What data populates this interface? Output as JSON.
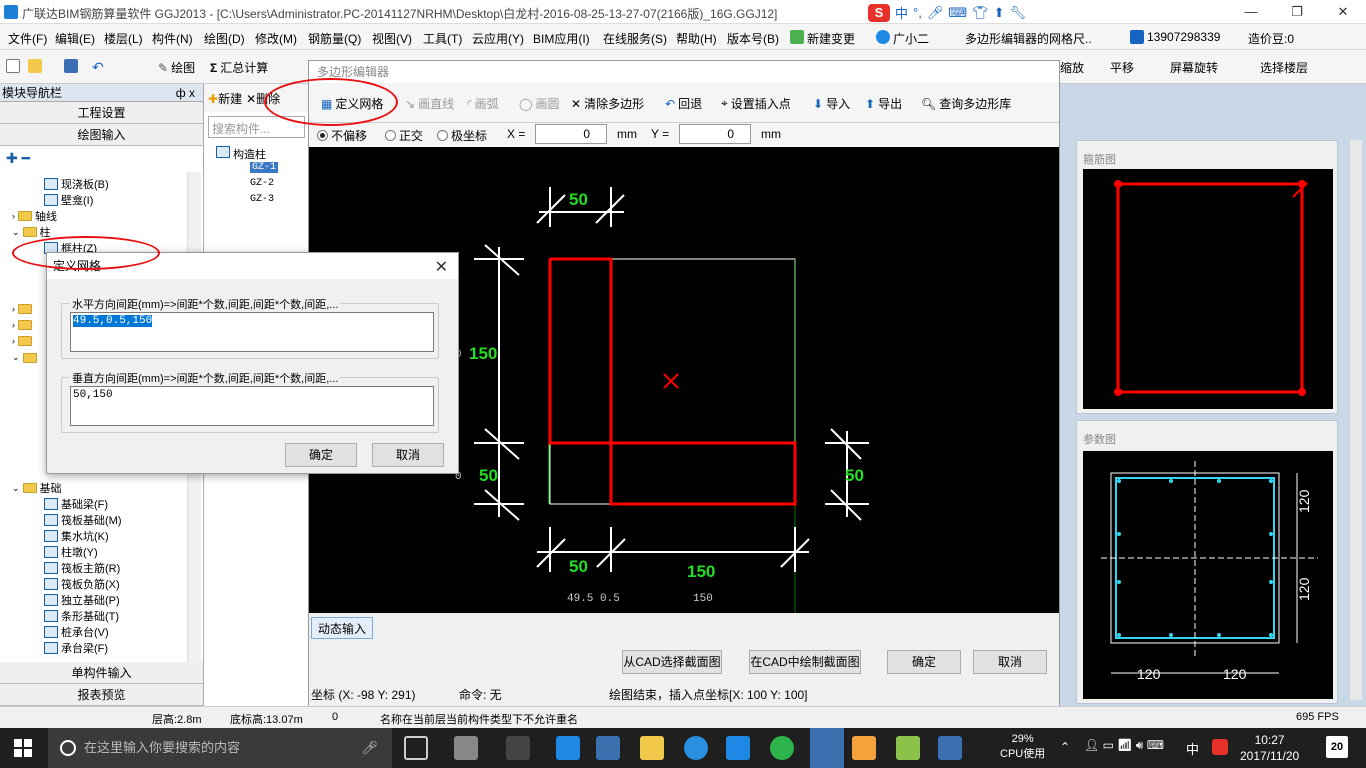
{
  "window": {
    "title": "广联达BIM钢筋算量软件 GGJ2013 - [C:\\Users\\Administrator.PC-20141127NRHM\\Desktop\\白龙村-2016-08-25-13-27-07(2166版)_16G.GGJ12]",
    "ime": {
      "brand": "S",
      "items": [
        "中",
        "°,",
        "mic",
        "keyboard",
        "skin",
        "upload",
        "tools"
      ]
    },
    "controls": {
      "minimize": "—",
      "restore": "❐",
      "close": "✕"
    }
  },
  "menu": [
    "文件(F)",
    "编辑(E)",
    "楼层(L)",
    "构件(N)",
    "绘图(D)",
    "修改(M)",
    "钢筋量(Q)",
    "视图(V)",
    "工具(T)",
    "云应用(Y)",
    "BIM应用(I)",
    "在线服务(S)",
    "帮助(H)",
    "版本号(B)",
    "新建变更",
    "广小二",
    "多边形编辑器的网格尺..",
    "13907298339",
    "造价豆:0"
  ],
  "toolbar": {
    "draw": "绘图",
    "sum": "汇总计算",
    "zoom": "缩放",
    "pan": "平移",
    "rotate": "屏幕旋转",
    "select_floor": "选择楼层",
    "move_down": "下移"
  },
  "leftnav": {
    "header": "模块导航栏",
    "pin": "ф x",
    "project_settings": "工程设置",
    "drawing_input": "绘图输入",
    "tree": [
      {
        "label": "现浇板(B)",
        "type": "elem"
      },
      {
        "label": "壁龛(I)",
        "type": "elem"
      },
      {
        "label": "轴线",
        "type": "folder"
      },
      {
        "label": "柱",
        "type": "folder"
      },
      {
        "label": "框柱(Z)",
        "type": "elem"
      },
      {
        "label": "基础",
        "type": "folder"
      },
      {
        "label": "基础梁(F)",
        "type": "elem"
      },
      {
        "label": "筏板基础(M)",
        "type": "elem"
      },
      {
        "label": "集水坑(K)",
        "type": "elem"
      },
      {
        "label": "柱墩(Y)",
        "type": "elem"
      },
      {
        "label": "筏板主筋(R)",
        "type": "elem"
      },
      {
        "label": "筏板负筋(X)",
        "type": "elem"
      },
      {
        "label": "独立基础(P)",
        "type": "elem"
      },
      {
        "label": "条形基础(T)",
        "type": "elem"
      },
      {
        "label": "桩承台(V)",
        "type": "elem"
      },
      {
        "label": "承台梁(F)",
        "type": "elem"
      }
    ],
    "single_input": "单构件输入",
    "report_preview": "报表预览"
  },
  "midpanel": {
    "new": "新建",
    "delete": "删除",
    "search_placeholder": "搜索构件...",
    "root": "构造柱",
    "items": [
      "GZ-1",
      "GZ-2",
      "GZ-3"
    ]
  },
  "editor": {
    "title": "多边形编辑器",
    "tools": {
      "define_grid": "定义网格",
      "line": "画直线",
      "arc3": "画弧",
      "circle": "画圆",
      "clear": "清除多边形",
      "undo": "回退",
      "set_insert": "设置插入点",
      "import": "导入",
      "export": "导出",
      "query_lib": "查询多边形库"
    },
    "options": {
      "no_offset": "不偏移",
      "orthogonal": "正交",
      "polar": "极坐标",
      "x_label": "X =",
      "x_value": "0",
      "y_label": "Y =",
      "y_value": "0",
      "unit": "mm"
    },
    "dims": {
      "top": "50",
      "left_150": "150",
      "left_50": "50",
      "right_50": "50",
      "bottom_50": "50",
      "bottom_150": "150",
      "grid_a": "49.5 0.5",
      "grid_b": "150",
      "left_0": "0",
      "left_0b": "0"
    },
    "dynamic_input": "动态输入",
    "btn_from_cad": "从CAD选择截面图",
    "btn_draw_cad": "在CAD中绘制截面图",
    "btn_ok": "确定",
    "btn_cancel": "取消",
    "status_coord": "坐标 (X: -98 Y: 291)",
    "status_cmd": "命令: 无",
    "status_msg": "绘图结束，插入点坐标[X: 100 Y: 100]"
  },
  "rightpanel": {
    "stirrup_label": "箍筋图",
    "param_label": "参数图",
    "dim_120a": "120",
    "dim_120b": "120",
    "dim_120c": "120",
    "dim_120d": "120"
  },
  "dialog": {
    "title": "定义网格",
    "close": "✕",
    "h_label": "水平方向间距(mm)=>间距*个数,间距,间距*个数,间距,...",
    "h_value": "49.5,0.5,150",
    "v_label": "垂直方向间距(mm)=>间距*个数,间距,间距*个数,间距,...",
    "v_value": "50,150",
    "ok": "确定",
    "cancel": "取消"
  },
  "statusbar": {
    "floor_height": "层高:2.8m",
    "bottom_height": "底标高:13.07m",
    "zero": "0",
    "message": "名称在当前层当前构件类型下不允许重名",
    "fps": "695 FPS"
  },
  "taskbar": {
    "search_placeholder": "在这里输入你要搜索的内容",
    "cpu_pct": "29%",
    "cpu_label": "CPU使用",
    "ime": "中",
    "time": "10:27",
    "date": "2017/11/20",
    "notif": "20"
  },
  "colors": {
    "accent": "#e81010",
    "grid": "#ffffff",
    "shape": "#ff0000",
    "dim": "#22dd22",
    "cyan": "#33d6f0"
  }
}
